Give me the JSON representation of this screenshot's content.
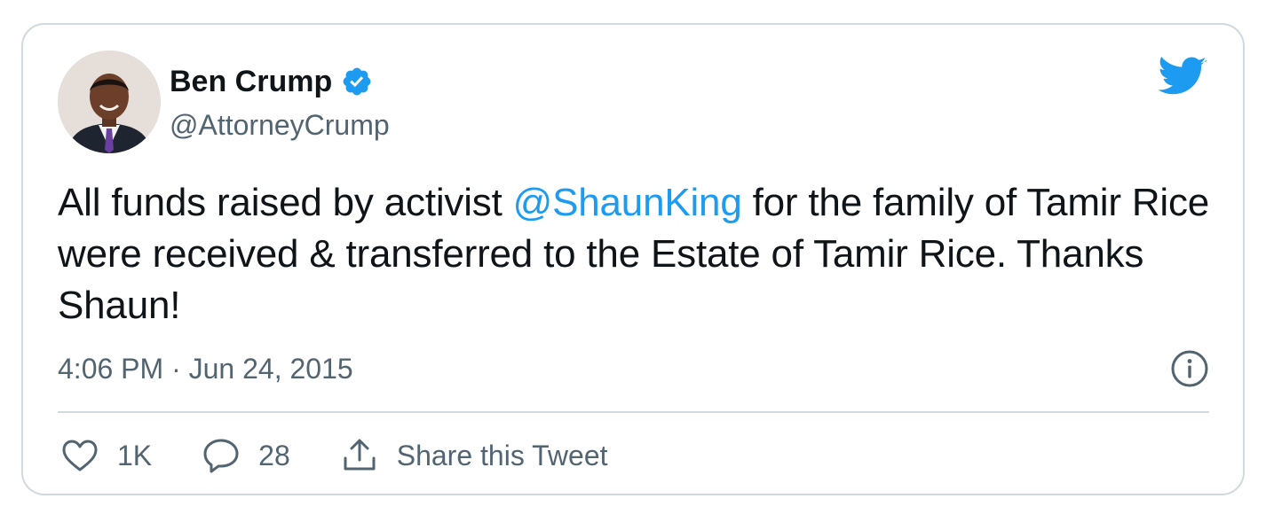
{
  "tweet": {
    "author": {
      "display_name": "Ben Crump",
      "handle": "@AttorneyCrump",
      "verified": true
    },
    "text_before": "All funds raised by activist ",
    "mention": "@ShaunKing",
    "text_after": " for the family of Tamir Rice were received & transferred to the Estate of Tamir Rice. Thanks Shaun!",
    "timestamp": "4:06 PM · Jun 24, 2015",
    "actions": {
      "like_count": "1K",
      "reply_count": "28",
      "share_label": "Share this Tweet"
    }
  },
  "icons": {
    "brand": "twitter-bird-icon",
    "verified": "verified-badge-icon",
    "info": "info-icon",
    "like": "heart-icon",
    "reply": "reply-bubble-icon",
    "share": "share-upload-icon"
  },
  "colors": {
    "accent": "#1d9bf0",
    "text": "#0f1419",
    "secondary": "#536471",
    "border": "#cfd9de"
  }
}
